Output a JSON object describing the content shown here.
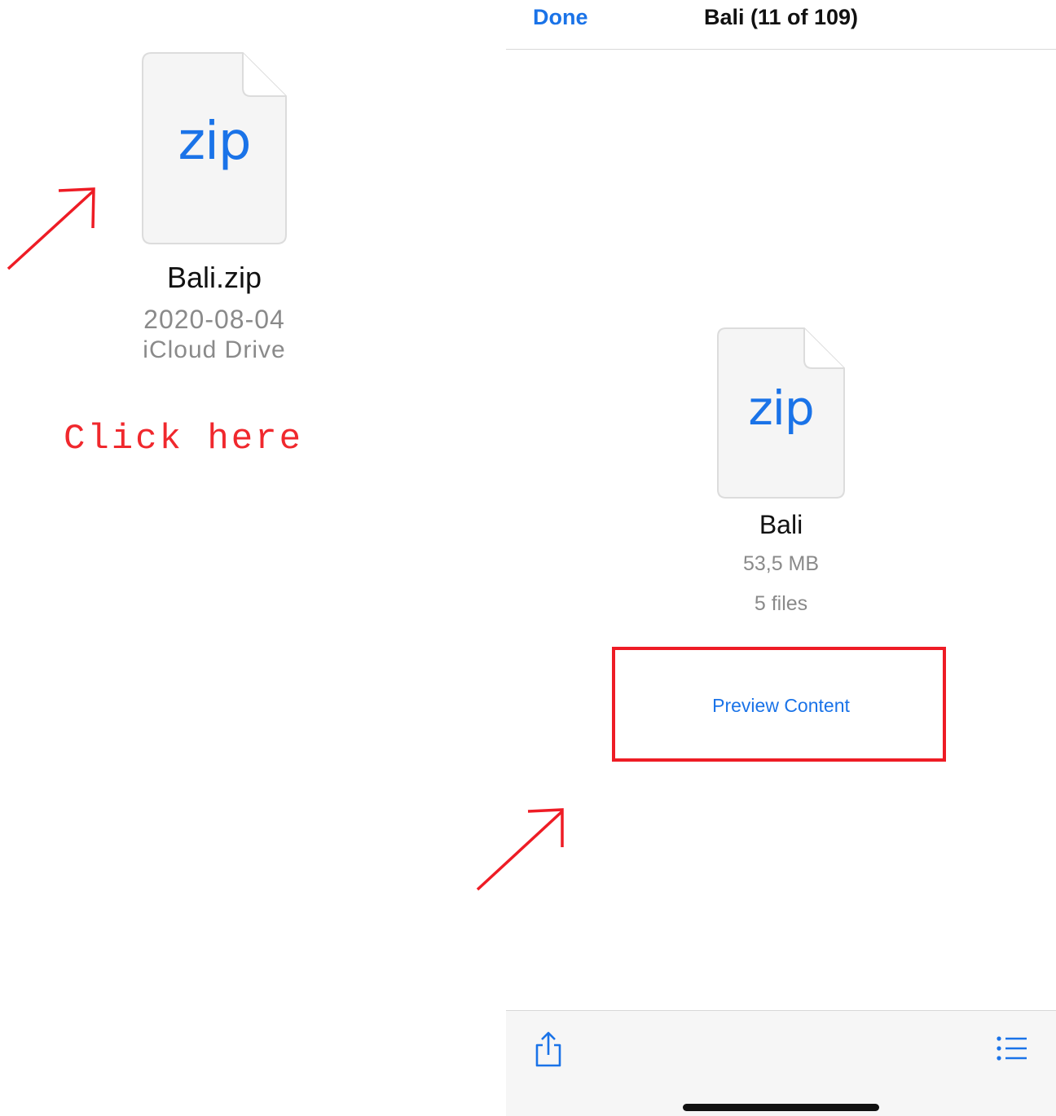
{
  "left_panel": {
    "file_icon_label": "zip",
    "filename": "Bali.zip",
    "date": "2020-08-04",
    "location": "iCloud Drive",
    "annotation": "Click here"
  },
  "preview": {
    "nav": {
      "done_label": "Done",
      "title": "Bali (11 of 109)"
    },
    "file_icon_label": "zip",
    "filename": "Bali",
    "size": "53,5 MB",
    "file_count": "5 files",
    "preview_button_label": "Preview Content",
    "toolbar": {
      "share_icon": "share-icon",
      "list_icon": "list-icon"
    }
  },
  "colors": {
    "accent": "#1a73e8",
    "annotation": "#ee1c25"
  }
}
